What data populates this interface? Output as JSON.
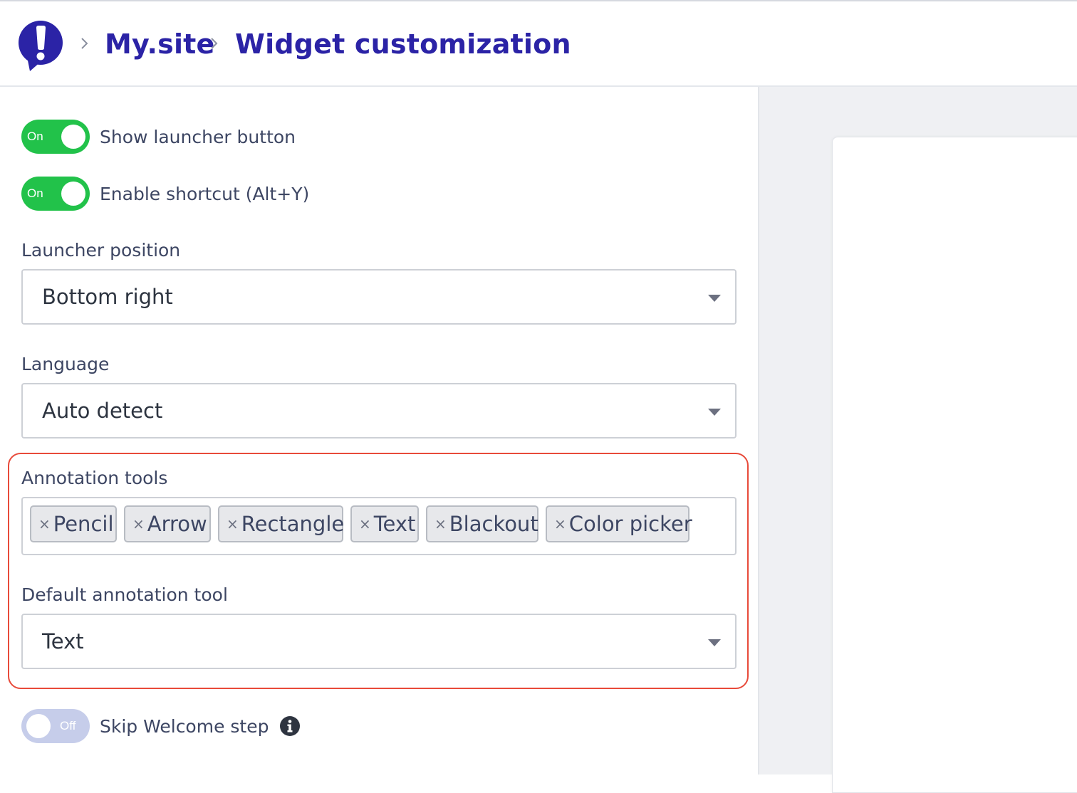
{
  "header": {
    "breadcrumb": [
      "My.site",
      "Widget customization"
    ]
  },
  "settings": {
    "show_launcher": {
      "state": "On",
      "label": "Show launcher button"
    },
    "enable_shortcut": {
      "state": "On",
      "label": "Enable shortcut (Alt+Y)"
    },
    "launcher_position": {
      "label": "Launcher position",
      "value": "Bottom right"
    },
    "language": {
      "label": "Language",
      "value": "Auto detect"
    },
    "annotation_tools": {
      "label": "Annotation tools",
      "remove_symbol": "×",
      "tags": [
        "Pencil",
        "Arrow",
        "Rectangle",
        "Text",
        "Blackout",
        "Color picker"
      ]
    },
    "default_annotation_tool": {
      "label": "Default annotation tool",
      "value": "Text"
    },
    "skip_welcome": {
      "state": "Off",
      "label": "Skip Welcome step"
    }
  },
  "colors": {
    "brand": "#2b23a6",
    "toggle_on": "#22c24a",
    "toggle_off": "#c6cdea",
    "highlight": "#e84a3a"
  },
  "icons": [
    "logo-icon",
    "chevron-right-icon",
    "caret-down-icon",
    "info-icon",
    "close-icon"
  ]
}
